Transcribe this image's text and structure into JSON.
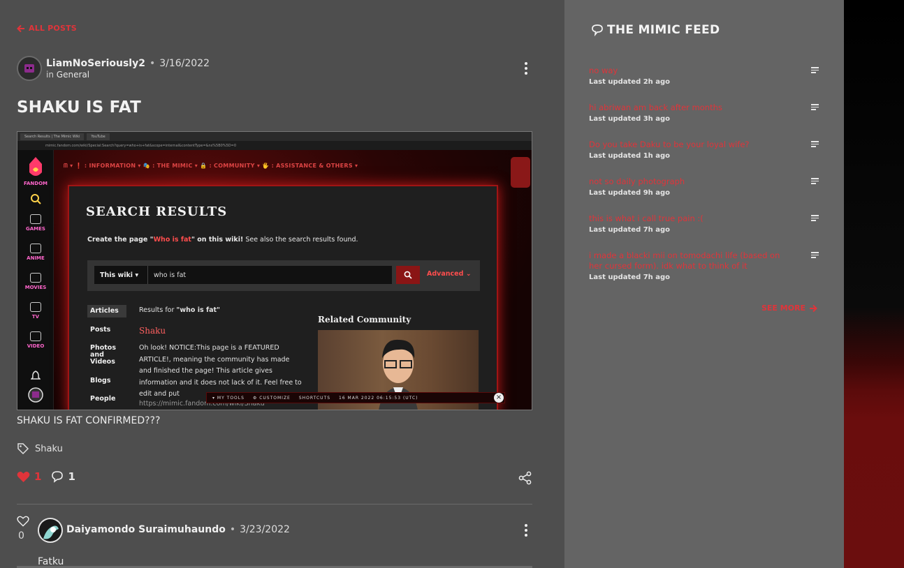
{
  "nav": {
    "back_label": "ALL POSTS"
  },
  "post": {
    "author": "LiamNoSeriously2",
    "date": "3/16/2022",
    "category_prefix": "in",
    "category": "General",
    "title": "SHAKU IS FAT",
    "body": "SHAKU IS FAT CONFIRMED???",
    "tag": "Shaku",
    "likes": "1",
    "comments": "1"
  },
  "embedded_screenshot": {
    "tab1": "Search Results | The Mimic Wiki",
    "tab2": "YouTube",
    "url": "mimic.fandom.com/wiki/Special:Search?query=who+is+fat&scope=internal&contentType=&ns%5B0%5D=0",
    "sidebar": [
      "FANDOM",
      "GAMES",
      "ANIME",
      "MOVIES",
      "TV",
      "VIDEO"
    ],
    "nav_items": "ᗰ ▾    ❗ : INFORMATION ▾    🎭 : THE MIMIC ▾    🔒 : COMMUNITY ▾    🖐 : ASSISTANCE & OTHERS ▾",
    "heading": "SEARCH RESULTS",
    "create_prefix": "Create the page \"",
    "create_link": "Who is fat",
    "create_suffix": "\" on this wiki!",
    "create_tail": " See also the search results found.",
    "scope": "This wiki",
    "query": "who is fat",
    "advanced": "Advanced",
    "tabs": [
      "Articles",
      "Posts",
      "Photos and Videos",
      "Blogs",
      "People"
    ],
    "results_prefix": "Results for",
    "results_query": "\"who is fat\"",
    "result_title": "Shaku",
    "result_desc": "Oh look! NOTICE:This page is a FEATURED ARTICLE!, meaning the community has made and finished the page! This article gives information and it does not lack of it. Feel free to edit and put",
    "result_url": "https://mimic.fandom.com/wiki/Shaku",
    "related": "Related Community",
    "toolbar": [
      "▾ MY TOOLS",
      "⚙ CUSTOMIZE",
      "SHORTCUTS",
      "16 MAR 2022 06:15:53 (UTC)"
    ]
  },
  "reply": {
    "author": "Daiyamondo Suraimuhaundo",
    "date": "3/23/2022",
    "likes": "0",
    "body": "Fatku"
  },
  "feed": {
    "title": "THE MIMIC FEED",
    "items": [
      {
        "title": "no way",
        "time": "Last updated 2h ago"
      },
      {
        "title": "hi abriwan am back after months",
        "time": "Last updated 3h ago"
      },
      {
        "title": "Do you take Daku to be your loyal wife?",
        "time": "Last updated 1h ago"
      },
      {
        "title": "not so daily photograph",
        "time": "Last updated 9h ago"
      },
      {
        "title": "this is what i call true pain :(",
        "time": "Last updated 7h ago"
      },
      {
        "title": "i made a blacki mii on tomodachi life (based on her cursed form). idk what to think of it",
        "time": "Last updated 7h ago"
      }
    ],
    "see_more": "SEE MORE"
  },
  "colors": {
    "accent": "#e0343a",
    "page_bg": "#4e4e4e",
    "feed_bg": "#646464"
  }
}
